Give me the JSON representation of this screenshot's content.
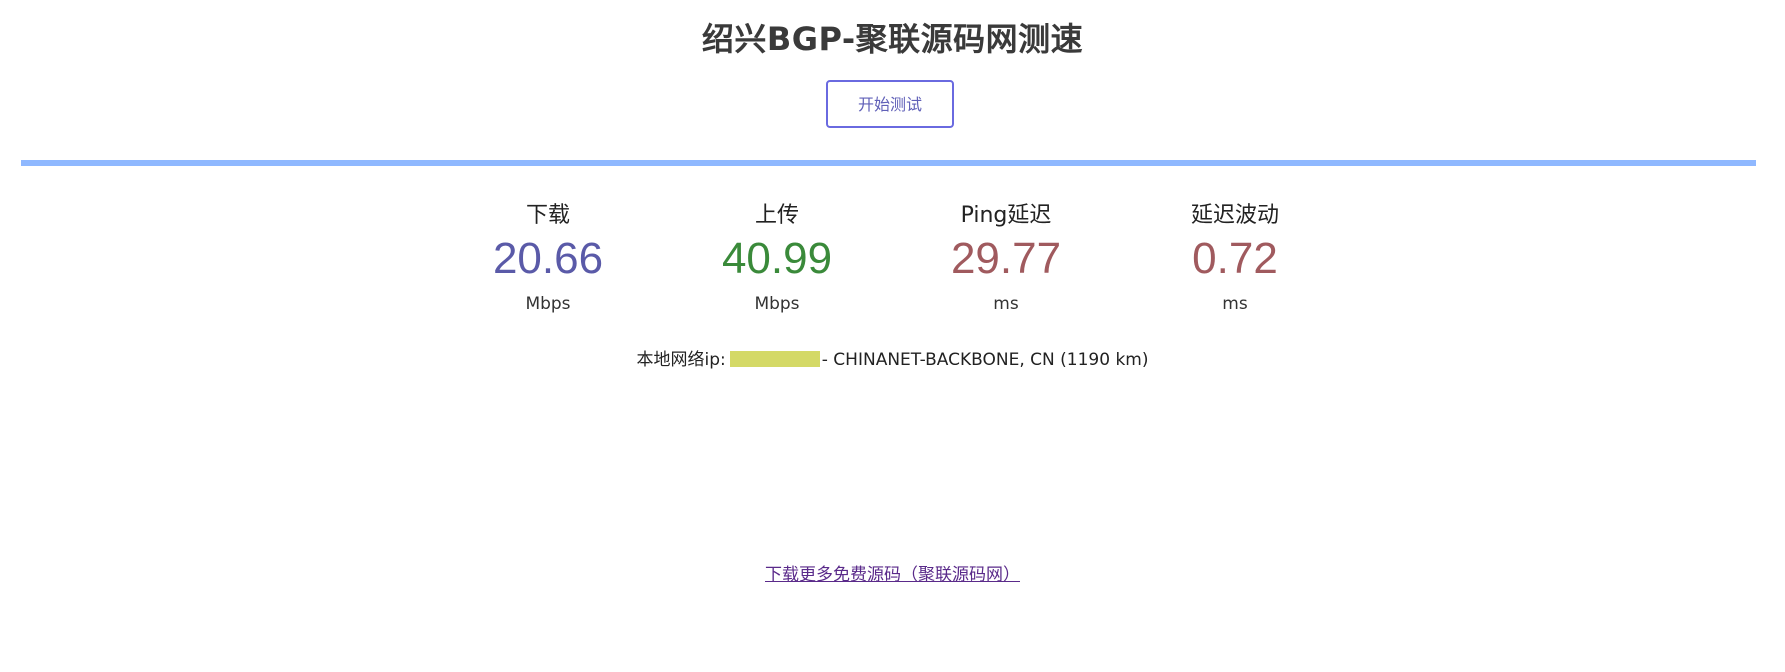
{
  "page": {
    "title": "绍兴BGP-聚联源码网测速"
  },
  "controls": {
    "start_label": "开始测试"
  },
  "progress": {
    "fraction": 1.0,
    "color": "#8fb8ff"
  },
  "metrics": [
    {
      "label": "下载",
      "value": "20.66",
      "unit": "Mbps",
      "color": "#5a5aa8"
    },
    {
      "label": "上传",
      "value": "40.99",
      "unit": "Mbps",
      "color": "#3a8a3a"
    },
    {
      "label": "Ping延迟",
      "value": "29.77",
      "unit": "ms",
      "color": "#a05a5e"
    },
    {
      "label": "延迟波动",
      "value": "0.72",
      "unit": "ms",
      "color": "#a05a5e"
    }
  ],
  "network": {
    "prefix": "本地网络ip:",
    "ip_masked_color": "#d4d966",
    "suffix": "- CHINANET-BACKBONE, CN (1190 km)"
  },
  "footer": {
    "link_text": "下载更多免费源码（聚联源码网）"
  }
}
